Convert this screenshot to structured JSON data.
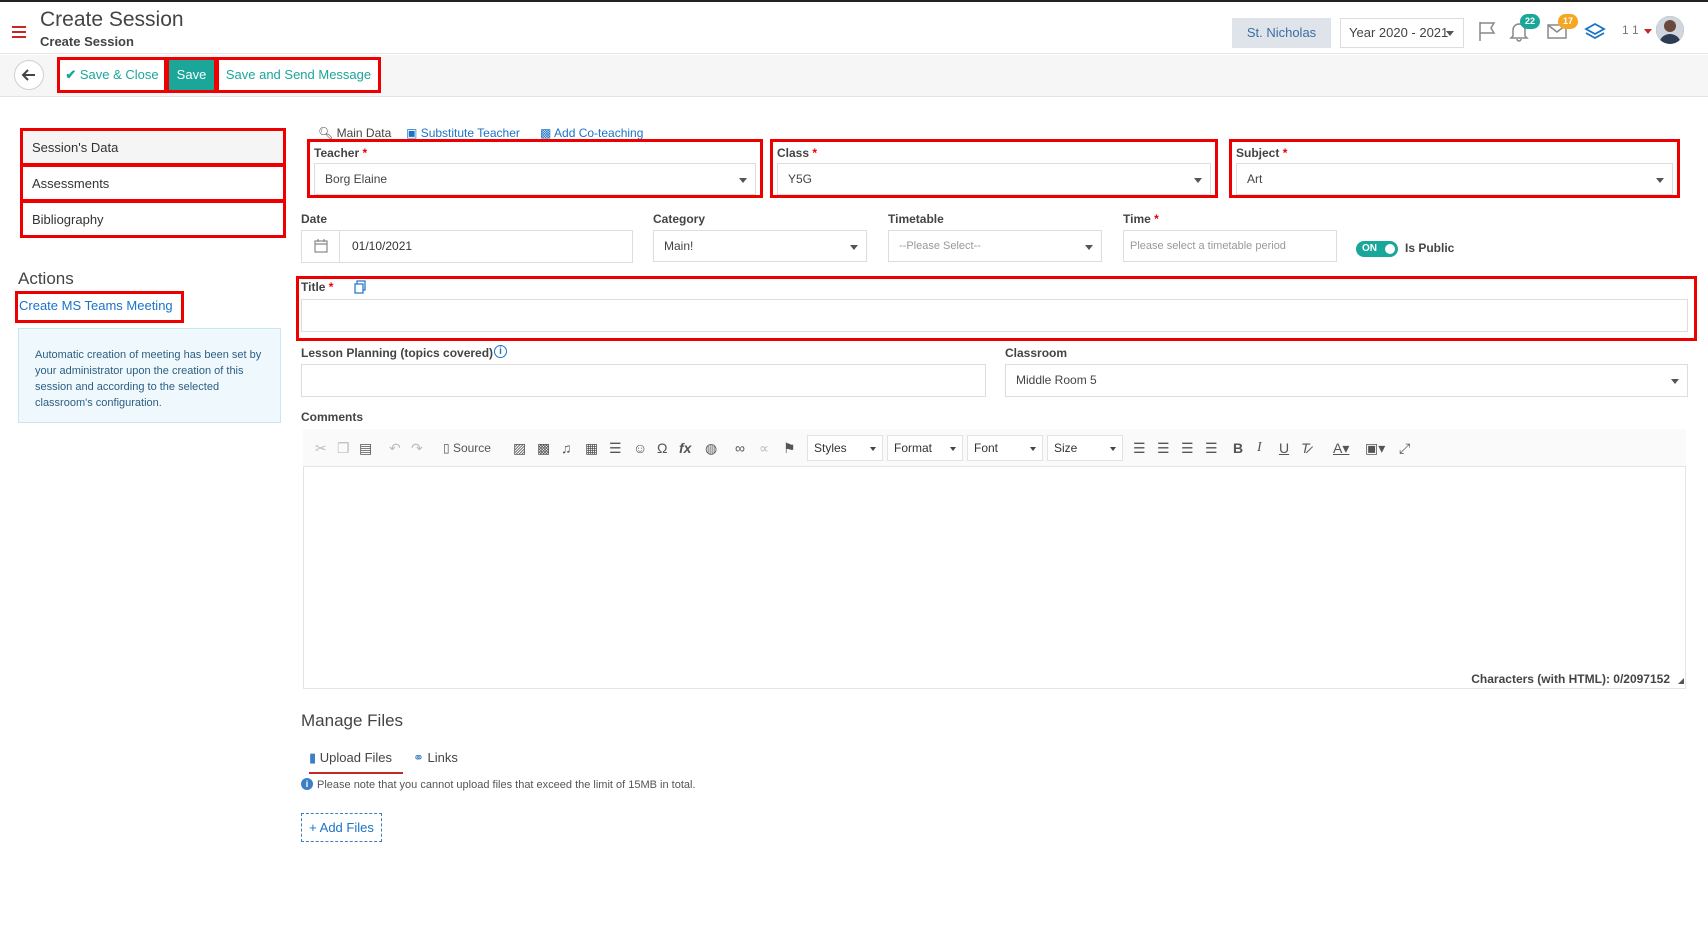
{
  "header": {
    "title": "Create Session",
    "subtitle": "Create Session",
    "school": "St. Nicholas",
    "year": "Year 2020 - 2021",
    "notifications_count": "22",
    "messages_count": "17",
    "user_text": "1 1"
  },
  "toolbar": {
    "save_close": "Save & Close",
    "save": "Save",
    "save_send": "Save and Send Message"
  },
  "sidebar": {
    "items": [
      {
        "label": "Session's Data"
      },
      {
        "label": "Assessments"
      },
      {
        "label": "Bibliography"
      }
    ],
    "actions_title": "Actions",
    "ms_teams_link": "Create MS Teams Meeting",
    "info_text": "Automatic creation of meeting has been set by your administrator upon the creation of this session and according to the selected classroom's configuration."
  },
  "subtabs": {
    "main_data": "Main Data",
    "substitute": "Substitute Teacher",
    "coteaching": "Add Co-teaching"
  },
  "form": {
    "teacher": {
      "label": "Teacher",
      "value": "Borg Elaine"
    },
    "class": {
      "label": "Class",
      "value": "Y5G"
    },
    "subject": {
      "label": "Subject",
      "value": "Art"
    },
    "date": {
      "label": "Date",
      "value": "01/10/2021"
    },
    "category": {
      "label": "Category",
      "value": "Main!"
    },
    "timetable": {
      "label": "Timetable",
      "placeholder": "--Please Select--"
    },
    "time": {
      "label": "Time",
      "placeholder": "Please select a timetable period"
    },
    "is_public": {
      "toggle": "ON",
      "label": "Is Public"
    },
    "title": {
      "label": "Title",
      "value": ""
    },
    "lesson": {
      "label": "Lesson Planning (topics covered)",
      "value": ""
    },
    "classroom": {
      "label": "Classroom",
      "value": "Middle Room 5"
    },
    "comments": {
      "label": "Comments"
    },
    "required_mark": "*"
  },
  "editor": {
    "source": "Source",
    "styles": "Styles",
    "format": "Format",
    "font": "Font",
    "size": "Size",
    "characters": "Characters (with HTML): 0/2097152"
  },
  "files": {
    "title": "Manage Files",
    "tab_upload": "Upload Files",
    "tab_links": "Links",
    "note": "Please note that you cannot upload files that exceed the limit of 15MB in total.",
    "add_button": "+ Add Files"
  },
  "colors": {
    "accent": "#1aa79a",
    "highlight": "#e00000",
    "link": "#1a73c8"
  }
}
